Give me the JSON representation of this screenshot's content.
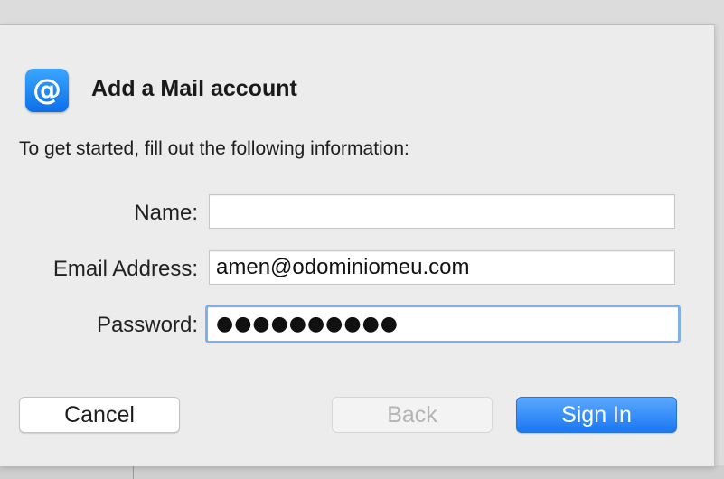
{
  "dialog": {
    "title": "Add a Mail account",
    "intro": "To get started, fill out the following information:",
    "icon": "at-sign-icon",
    "icon_glyph": "@"
  },
  "form": {
    "name_label": "Name:",
    "name_value": "",
    "email_label": "Email Address:",
    "email_value": "amen@odominiomeu.com",
    "password_label": "Password:",
    "password_masked": "●●●●●●●●●●"
  },
  "buttons": {
    "cancel": "Cancel",
    "back": "Back",
    "sign_in": "Sign In"
  },
  "colors": {
    "accent": "#1a78f2",
    "focus_ring": "#7fb0ea",
    "disabled_text": "#b4b4b4"
  }
}
